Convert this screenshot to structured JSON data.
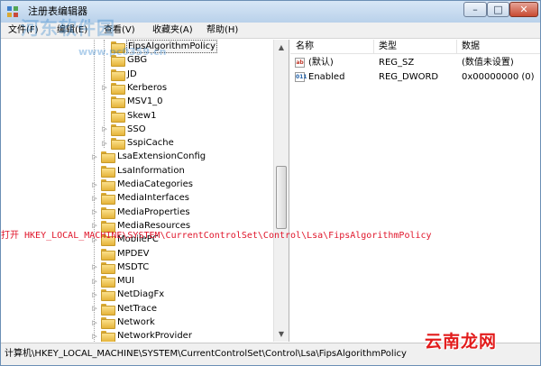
{
  "window": {
    "title": "注册表编辑器"
  },
  "menu": [
    {
      "label": "文件(F)"
    },
    {
      "label": "编辑(E)"
    },
    {
      "label": "查看(V)"
    },
    {
      "label": "收藏夹(A)"
    },
    {
      "label": "帮助(H)"
    }
  ],
  "watermark": {
    "site": "河东软件园",
    "url": "www.pc0359.cn"
  },
  "tree": {
    "items": [
      {
        "label": "FipsAlgorithmPolicy",
        "selected": true,
        "expandable": false,
        "level": 2
      },
      {
        "label": "GBG",
        "expandable": false,
        "level": 2
      },
      {
        "label": "JD",
        "expandable": false,
        "level": 2
      },
      {
        "label": "Kerberos",
        "expandable": true,
        "level": 2
      },
      {
        "label": "MSV1_0",
        "expandable": false,
        "level": 2
      },
      {
        "label": "Skew1",
        "expandable": false,
        "level": 2
      },
      {
        "label": "SSO",
        "expandable": true,
        "level": 2
      },
      {
        "label": "SspiCache",
        "expandable": true,
        "level": 2
      },
      {
        "label": "LsaExtensionConfig",
        "expandable": true,
        "level": 1
      },
      {
        "label": "LsaInformation",
        "expandable": false,
        "level": 1
      },
      {
        "label": "MediaCategories",
        "expandable": true,
        "level": 1
      },
      {
        "label": "MediaInterfaces",
        "expandable": true,
        "level": 1
      },
      {
        "label": "MediaProperties",
        "expandable": true,
        "level": 1
      },
      {
        "label": "MediaResources",
        "expandable": true,
        "level": 1
      },
      {
        "label": "MobilePC",
        "expandable": true,
        "level": 1
      },
      {
        "label": "MPDEV",
        "expandable": false,
        "level": 1
      },
      {
        "label": "MSDTC",
        "expandable": true,
        "level": 1
      },
      {
        "label": "MUI",
        "expandable": true,
        "level": 1
      },
      {
        "label": "NetDiagFx",
        "expandable": true,
        "level": 1
      },
      {
        "label": "NetTrace",
        "expandable": true,
        "level": 1
      },
      {
        "label": "Network",
        "expandable": true,
        "level": 1
      },
      {
        "label": "NetworkProvider",
        "expandable": true,
        "level": 1
      }
    ]
  },
  "list": {
    "columns": {
      "name": "名称",
      "type": "类型",
      "data": "数据"
    },
    "rows": [
      {
        "icon": "string-value-icon",
        "icon_glyph": "ab",
        "name": "(默认)",
        "type": "REG_SZ",
        "data": "(数值未设置)"
      },
      {
        "icon": "dword-value-icon",
        "icon_glyph": "011",
        "name": "Enabled",
        "type": "REG_DWORD",
        "data": "0x00000000 (0)"
      }
    ]
  },
  "annotation": "打开 HKEY_LOCAL_MACHINE\\SYSTEM\\CurrentControlSet\\Control\\Lsa\\FipsAlgorithmPolicy",
  "status": {
    "path": "计算机\\HKEY_LOCAL_MACHINE\\SYSTEM\\CurrentControlSet\\Control\\Lsa\\FipsAlgorithmPolicy"
  },
  "corner_logo": "云南龙网",
  "colors": {
    "annotation": "#e0162b",
    "folder": "#e5b43a",
    "logo": "#e21b1b"
  }
}
